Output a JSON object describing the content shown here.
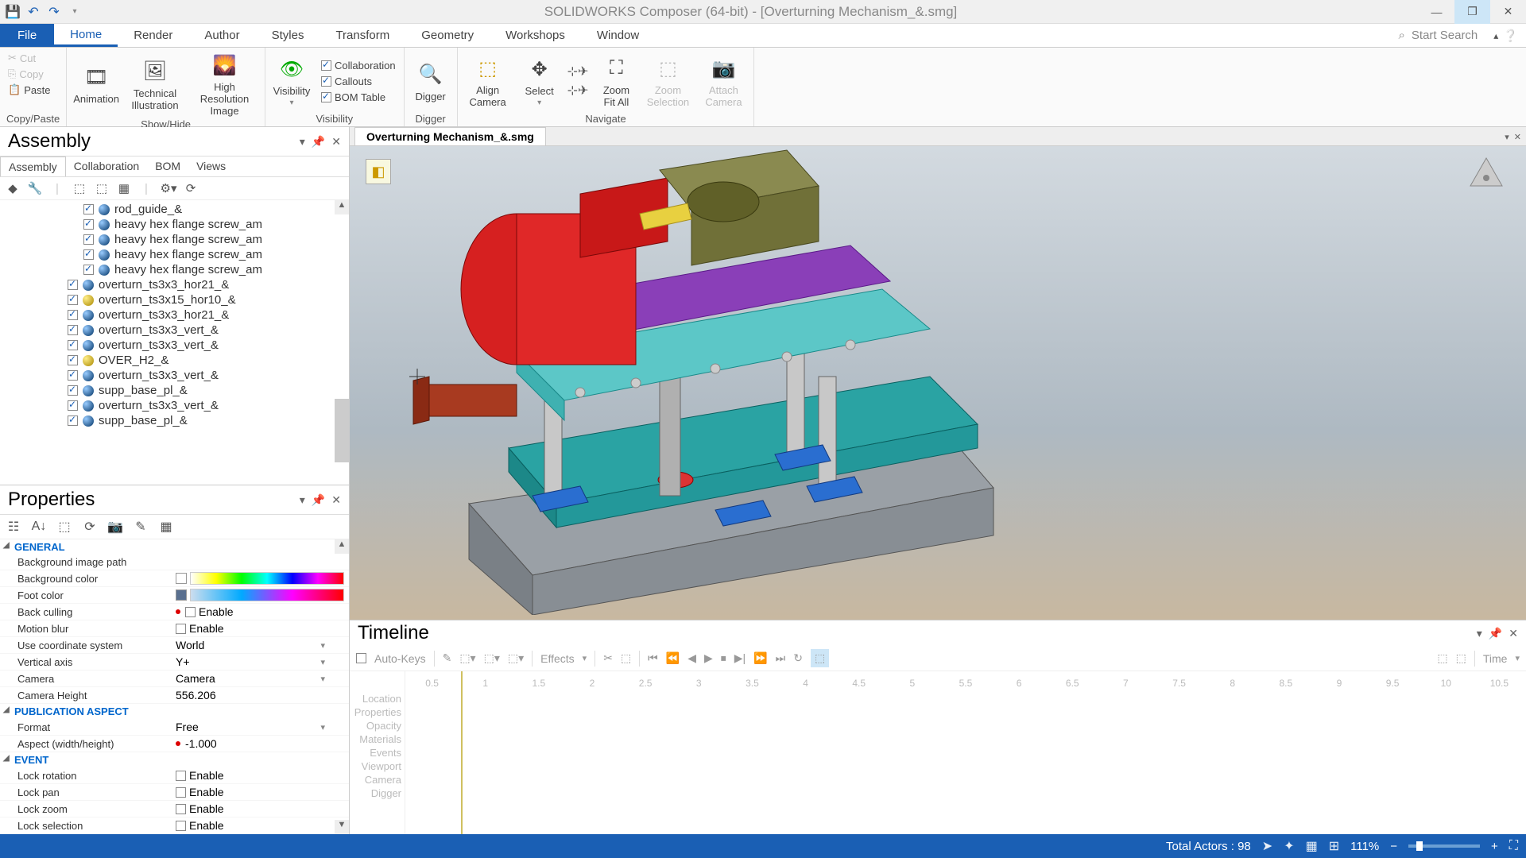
{
  "titlebar": {
    "title": "SOLIDWORKS Composer (64-bit) - [Overturning Mechanism_&.smg]"
  },
  "ribbon_tabs": {
    "file": "File",
    "items": [
      "Home",
      "Render",
      "Author",
      "Styles",
      "Transform",
      "Geometry",
      "Workshops",
      "Window"
    ],
    "active": "Home",
    "search_placeholder": "Start Search"
  },
  "ribbon": {
    "copypaste": {
      "cut": "Cut",
      "copy": "Copy",
      "paste": "Paste",
      "label": "Copy/Paste"
    },
    "showhide": {
      "animation": "Animation",
      "technical": "Technical Illustration",
      "highres": "High Resolution Image",
      "label": "Show/Hide"
    },
    "visibility": {
      "visibility": "Visibility",
      "collaboration": "Collaboration",
      "callouts": "Callouts",
      "bom": "BOM Table",
      "label": "Visibility"
    },
    "digger": {
      "digger": "Digger",
      "label": "Digger"
    },
    "navigate": {
      "align": "Align Camera",
      "select": "Select",
      "zoomfit": "Zoom Fit All",
      "zoomsel": "Zoom Selection",
      "attach": "Attach Camera",
      "label": "Navigate"
    }
  },
  "assembly_panel": {
    "title": "Assembly",
    "tabs": [
      "Assembly",
      "Collaboration",
      "BOM",
      "Views"
    ],
    "tree": [
      {
        "label": "rod_guide_&",
        "indent": true,
        "icon": "blue"
      },
      {
        "label": "heavy hex flange screw_am",
        "indent": true,
        "icon": "blue"
      },
      {
        "label": "heavy hex flange screw_am",
        "indent": true,
        "icon": "blue"
      },
      {
        "label": "heavy hex flange screw_am",
        "indent": true,
        "icon": "blue"
      },
      {
        "label": "heavy hex flange screw_am",
        "indent": true,
        "icon": "blue"
      },
      {
        "label": "overturn_ts3x3_hor21_&",
        "indent": false,
        "icon": "blue"
      },
      {
        "label": "overturn_ts3x15_hor10_&",
        "indent": false,
        "icon": "ylw"
      },
      {
        "label": "overturn_ts3x3_hor21_&",
        "indent": false,
        "icon": "blue"
      },
      {
        "label": "overturn_ts3x3_vert_&",
        "indent": false,
        "icon": "blue"
      },
      {
        "label": "overturn_ts3x3_vert_&",
        "indent": false,
        "icon": "blue"
      },
      {
        "label": "OVER_H2_&",
        "indent": false,
        "icon": "ylw"
      },
      {
        "label": "overturn_ts3x3_vert_&",
        "indent": false,
        "icon": "blue"
      },
      {
        "label": "supp_base_pl_&",
        "indent": false,
        "icon": "blue"
      },
      {
        "label": "overturn_ts3x3_vert_&",
        "indent": false,
        "icon": "blue"
      },
      {
        "label": "supp_base_pl_&",
        "indent": false,
        "icon": "blue"
      }
    ]
  },
  "properties_panel": {
    "title": "Properties",
    "sections": {
      "general": "GENERAL",
      "publication": "PUBLICATION ASPECT",
      "event": "EVENT"
    },
    "rows": {
      "bg_image": {
        "name": "Background image path",
        "value": ""
      },
      "bg_color": {
        "name": "Background color"
      },
      "foot_color": {
        "name": "Foot color"
      },
      "back_culling": {
        "name": "Back culling",
        "value": "Enable"
      },
      "motion_blur": {
        "name": "Motion blur",
        "value": "Enable"
      },
      "coord_sys": {
        "name": "Use coordinate system",
        "value": "World"
      },
      "vert_axis": {
        "name": "Vertical axis",
        "value": "Y+"
      },
      "camera": {
        "name": "Camera",
        "value": "Camera"
      },
      "cam_height": {
        "name": "Camera Height",
        "value": "556.206"
      },
      "format": {
        "name": "Format",
        "value": "Free"
      },
      "aspect": {
        "name": "Aspect (width/height)",
        "value": "-1.000"
      },
      "lock_rot": {
        "name": "Lock rotation",
        "value": "Enable"
      },
      "lock_pan": {
        "name": "Lock pan",
        "value": "Enable"
      },
      "lock_zoom": {
        "name": "Lock zoom",
        "value": "Enable"
      },
      "lock_sel": {
        "name": "Lock selection",
        "value": "Enable"
      }
    }
  },
  "document": {
    "tab": "Overturning Mechanism_&.smg"
  },
  "timeline": {
    "title": "Timeline",
    "autokeys": "Auto-Keys",
    "effects": "Effects",
    "time": "Time",
    "tracks": [
      "Location",
      "Properties",
      "Opacity",
      "Materials",
      "Events",
      "Viewport",
      "Camera",
      "Digger"
    ],
    "ticks": [
      "0.5",
      "1",
      "1.5",
      "2",
      "2.5",
      "3",
      "3.5",
      "4",
      "4.5",
      "5",
      "5.5",
      "6",
      "6.5",
      "7",
      "7.5",
      "8",
      "8.5",
      "9",
      "9.5",
      "10",
      "10.5"
    ]
  },
  "statusbar": {
    "actors": "Total Actors : 98",
    "zoom": "111%"
  }
}
